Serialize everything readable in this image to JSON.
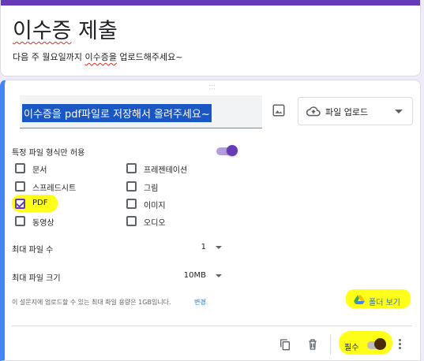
{
  "header": {
    "title_part1": "이수증",
    "title_part2": " 제출",
    "description_part1": "다음 주 월요일까지 ",
    "description_part2": "이수증을",
    "description_part3": " 업로드해주세요~"
  },
  "question": {
    "title": "이수증을 pdf파일로 저장해서 올려주세요~",
    "type_label": "파일 업로드",
    "allow_specific_types_label": "특정 파일 형식만 허용",
    "allow_specific_types_on": true,
    "file_types": [
      {
        "label": "문서",
        "checked": false
      },
      {
        "label": "프레젠테이션",
        "checked": false
      },
      {
        "label": "스프레드시트",
        "checked": false
      },
      {
        "label": "그림",
        "checked": false
      },
      {
        "label": "PDF",
        "checked": true
      },
      {
        "label": "이미지",
        "checked": false
      },
      {
        "label": "동영상",
        "checked": false
      },
      {
        "label": "오디오",
        "checked": false
      }
    ],
    "max_files_label": "최대 파일 수",
    "max_files_value": "1",
    "max_size_label": "최대 파일 크기",
    "max_size_value": "10MB",
    "note": "이 설문지에 업로드할 수 있는 최대 파일 용량은 1GB입니다.",
    "note_link": "변경",
    "folder_view_label": "폴더 보기",
    "required_label": "필수",
    "required_on": false
  },
  "colors": {
    "accent": "#673ab7",
    "active_border": "#4285f4",
    "highlight": "#ffff00",
    "selection": "#1a56c4",
    "link": "#1a73e8"
  },
  "icons": [
    "image-icon",
    "cloud-upload-icon",
    "chevron-down-icon",
    "drive-icon",
    "copy-icon",
    "trash-icon",
    "more-vert-icon",
    "drag-handle-icon"
  ]
}
